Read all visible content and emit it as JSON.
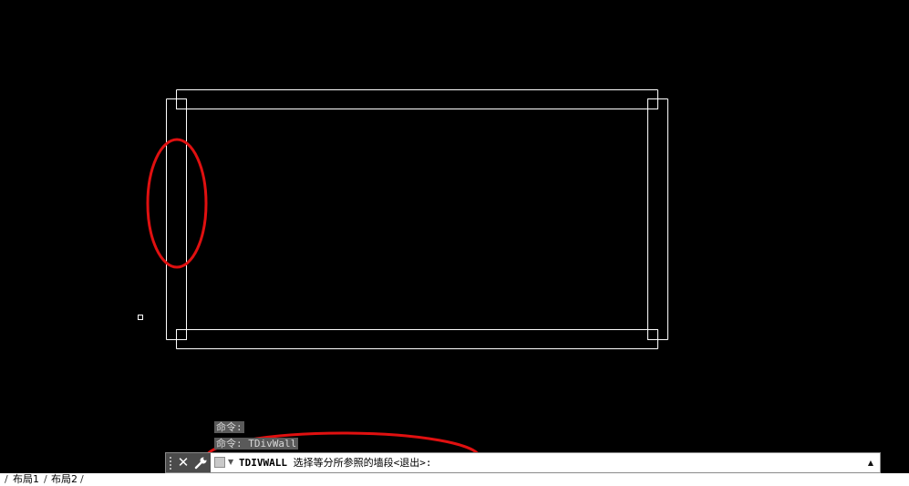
{
  "command_history": [
    "命令:",
    "命令: TDivWall"
  ],
  "command_line": {
    "keyword": "TDIVWALL",
    "prompt": "选择等分所参照的墙段<退出>:"
  },
  "layout_tabs": [
    "布局1",
    "布局2"
  ],
  "icons": {
    "close": "close-icon",
    "customize": "wrench-icon",
    "prompt": "command-prompt-icon",
    "dropdown": "chevron-up-icon"
  },
  "colors": {
    "canvas": "#000000",
    "wall_lines": "#ffffff",
    "annotation": "#e01010"
  }
}
